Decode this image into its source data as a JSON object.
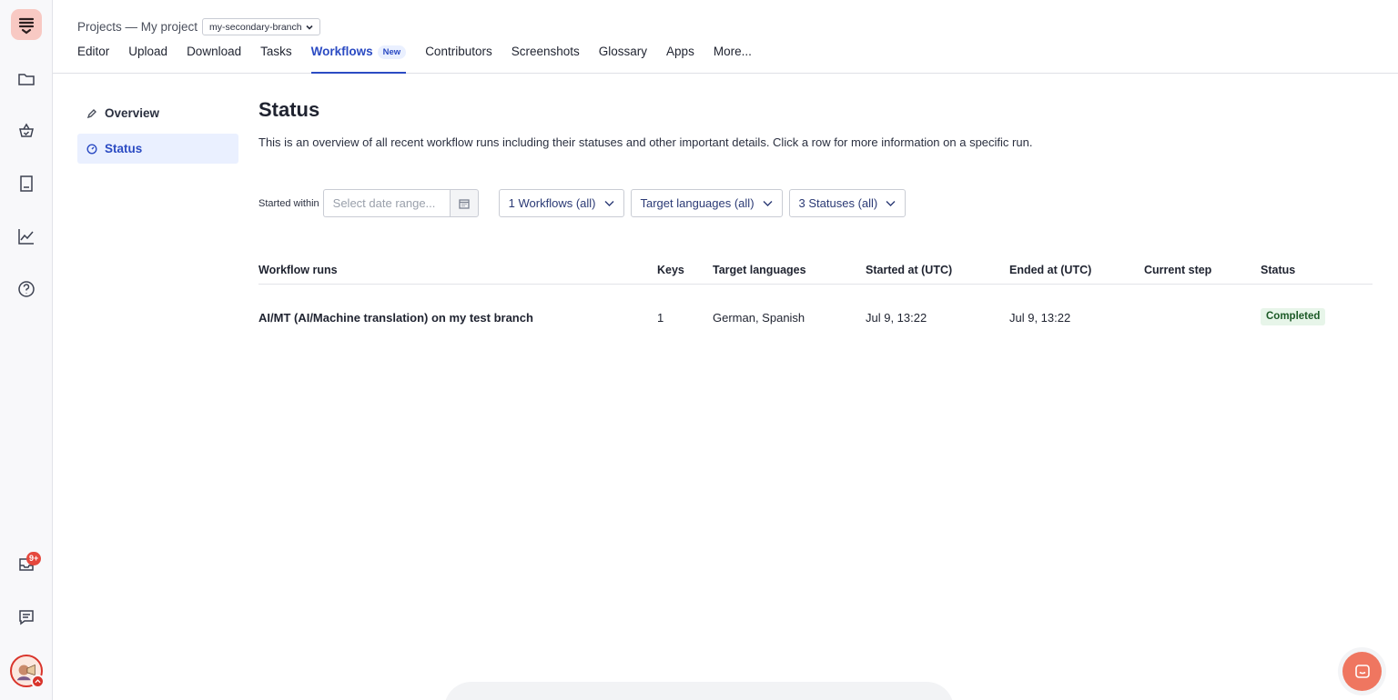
{
  "rail": {
    "items": [
      "folder",
      "basket",
      "book",
      "chart",
      "help",
      "inbox",
      "messages"
    ],
    "notification_badge": "9+"
  },
  "header": {
    "breadcrumb": "Projects — My project",
    "branch": "my-secondary-branch",
    "nav": [
      {
        "label": "Editor"
      },
      {
        "label": "Upload"
      },
      {
        "label": "Download"
      },
      {
        "label": "Tasks"
      },
      {
        "label": "Workflows",
        "badge": "New",
        "active": true
      },
      {
        "label": "Contributors"
      },
      {
        "label": "Screenshots"
      },
      {
        "label": "Glossary"
      },
      {
        "label": "Apps"
      },
      {
        "label": "More..."
      }
    ]
  },
  "side": {
    "overview": "Overview",
    "status": "Status"
  },
  "main": {
    "title": "Status",
    "description": "This is an overview of all recent workflow runs including their statuses and other important details. Click a row for more information on a specific run.",
    "filters": {
      "started_within_label": "Started within",
      "date_placeholder": "Select date range...",
      "workflows": "1 Workflows (all)",
      "target_languages": "Target languages (all)",
      "statuses": "3 Statuses (all)"
    },
    "table": {
      "headers": {
        "workflow_runs": "Workflow runs",
        "keys": "Keys",
        "target_languages": "Target languages",
        "started_at": "Started at (UTC)",
        "ended_at": "Ended at (UTC)",
        "current_step": "Current step",
        "status": "Status"
      },
      "rows": [
        {
          "workflow": "AI/MT (AI/Machine translation) on my test branch",
          "keys": "1",
          "target_languages": "German, Spanish",
          "started_at": "Jul 9, 13:22",
          "ended_at": "Jul 9, 13:22",
          "current_step": "",
          "status": "Completed"
        }
      ]
    }
  },
  "colors": {
    "accent": "#2b4bc3",
    "brand": "#ef7660",
    "status_completed_bg": "#e7f5e9",
    "status_completed_text": "#1c5a27"
  }
}
